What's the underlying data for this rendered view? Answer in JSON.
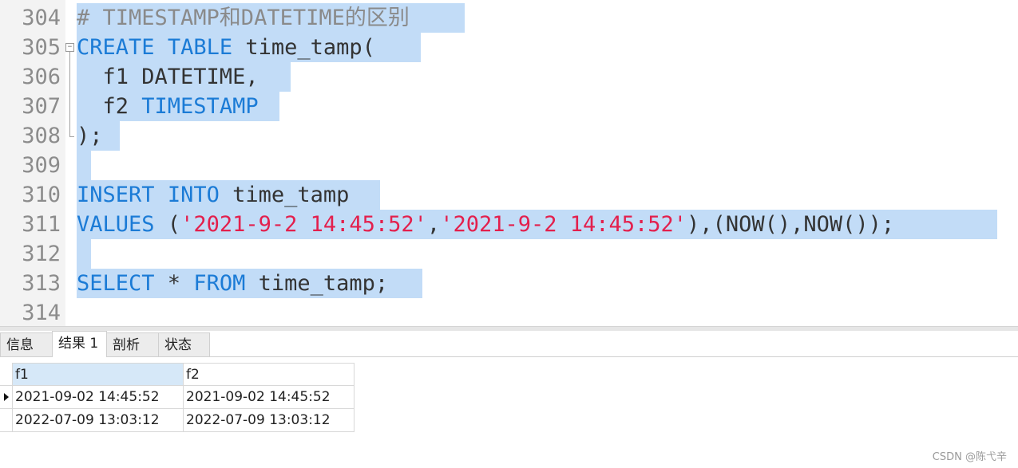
{
  "editor": {
    "lines": [
      {
        "number": "304",
        "tokens": [
          {
            "t": "# TIMESTAMP和DATETIME的区别",
            "c": "cmt"
          }
        ]
      },
      {
        "number": "305",
        "tokens": [
          {
            "t": "CREATE",
            "c": "kw"
          },
          {
            "t": " "
          },
          {
            "t": "TABLE",
            "c": "kw"
          },
          {
            "t": " time_tamp("
          }
        ]
      },
      {
        "number": "306",
        "tokens": [
          {
            "t": "  f1 DATETIME,"
          }
        ]
      },
      {
        "number": "307",
        "tokens": [
          {
            "t": "  f2 "
          },
          {
            "t": "TIMESTAMP",
            "c": "kw"
          }
        ]
      },
      {
        "number": "308",
        "tokens": [
          {
            "t": ");"
          }
        ]
      },
      {
        "number": "309",
        "tokens": []
      },
      {
        "number": "310",
        "tokens": [
          {
            "t": "INSERT",
            "c": "kw"
          },
          {
            "t": " "
          },
          {
            "t": "INTO",
            "c": "kw"
          },
          {
            "t": " time_tamp"
          }
        ]
      },
      {
        "number": "311",
        "tokens": [
          {
            "t": "VALUES",
            "c": "kw"
          },
          {
            "t": " ("
          },
          {
            "t": "'2021-9-2 14:45:52'",
            "c": "str"
          },
          {
            "t": ","
          },
          {
            "t": "'2021-9-2 14:45:52'",
            "c": "str"
          },
          {
            "t": "),(NOW(),NOW());"
          }
        ]
      },
      {
        "number": "312",
        "tokens": []
      },
      {
        "number": "313",
        "tokens": [
          {
            "t": "SELECT",
            "c": "kw"
          },
          {
            "t": " * "
          },
          {
            "t": "FROM",
            "c": "kw"
          },
          {
            "t": " time_tamp;"
          }
        ]
      },
      {
        "number": "314",
        "tokens": []
      }
    ],
    "fold_marker": "−"
  },
  "result_tabs": [
    {
      "label": "信息",
      "active": false
    },
    {
      "label": "结果 1",
      "active": true
    },
    {
      "label": "剖析",
      "active": false
    },
    {
      "label": "状态",
      "active": false
    }
  ],
  "result_grid": {
    "columns": [
      "f1",
      "f2"
    ],
    "rows": [
      [
        "2021-09-02 14:45:52",
        "2021-09-02 14:45:52"
      ],
      [
        "2022-07-09 13:03:12",
        "2022-07-09 13:03:12"
      ]
    ],
    "current_row": 0
  },
  "watermark": "CSDN @陈弋辛",
  "colors": {
    "keyword": "#1b7bd6",
    "string": "#e3204d",
    "comment": "#8a8a8a",
    "selection": "#c2dcf7",
    "gutter_bg": "#f3f3f3"
  }
}
